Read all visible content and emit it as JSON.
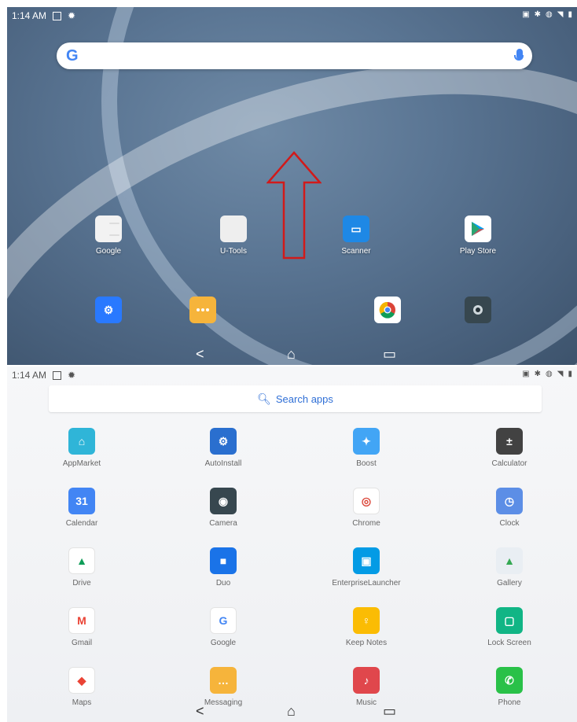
{
  "screens": {
    "home": {
      "status": {
        "time": "1:14 AM"
      },
      "search": {
        "logo": "G"
      },
      "apps": [
        {
          "label": "Google",
          "icon": "google-folder-icon"
        },
        {
          "label": "U-Tools",
          "icon": "utools-folder-icon"
        },
        {
          "label": "Scanner",
          "icon": "scanner-icon"
        },
        {
          "label": "Play Store",
          "icon": "play-store-icon"
        }
      ],
      "dock": [
        {
          "icon": "settings-icon"
        },
        {
          "icon": "messaging-icon"
        },
        {
          "icon": "chrome-icon"
        },
        {
          "icon": "camera-icon"
        }
      ],
      "nav": {
        "back": "<",
        "home": "⌂",
        "recents": "▭"
      }
    },
    "drawer": {
      "status": {
        "time": "1:14 AM"
      },
      "search_label": "Search apps",
      "apps": [
        {
          "label": "AppMarket",
          "icon": "appmarket-icon",
          "color": "#2fb5d8"
        },
        {
          "label": "AutoInstall",
          "icon": "autoinstall-icon",
          "color": "#2a6fcf"
        },
        {
          "label": "Boost",
          "icon": "boost-icon",
          "color": "#42a5f5"
        },
        {
          "label": "Calculator",
          "icon": "calculator-icon",
          "color": "#424242"
        },
        {
          "label": "Calendar",
          "icon": "calendar-icon",
          "color": "#4285f4"
        },
        {
          "label": "Camera",
          "icon": "camera-icon",
          "color": "#37474f"
        },
        {
          "label": "Chrome",
          "icon": "chrome-icon",
          "color": "#ffffff"
        },
        {
          "label": "Clock",
          "icon": "clock-icon",
          "color": "#5c8ee6"
        },
        {
          "label": "Drive",
          "icon": "drive-icon",
          "color": "#ffffff"
        },
        {
          "label": "Duo",
          "icon": "duo-icon",
          "color": "#1a73e8"
        },
        {
          "label": "EnterpriseLauncher",
          "icon": "enterprise-launcher-icon",
          "color": "#039be5"
        },
        {
          "label": "Gallery",
          "icon": "gallery-icon",
          "color": "#e9eef3"
        },
        {
          "label": "Gmail",
          "icon": "gmail-icon",
          "color": "#ffffff"
        },
        {
          "label": "Google",
          "icon": "google-icon",
          "color": "#ffffff"
        },
        {
          "label": "Keep Notes",
          "icon": "keep-notes-icon",
          "color": "#fbbc04"
        },
        {
          "label": "Lock Screen",
          "icon": "lock-screen-icon",
          "color": "#11b585"
        },
        {
          "label": "Maps",
          "icon": "maps-icon",
          "color": "#ffffff"
        },
        {
          "label": "Messaging",
          "icon": "messaging-icon",
          "color": "#f6b43b"
        },
        {
          "label": "Music",
          "icon": "music-icon",
          "color": "#e0474c"
        },
        {
          "label": "Phone",
          "icon": "phone-icon",
          "color": "#29c148"
        }
      ],
      "nav": {
        "back": "<",
        "home": "⌂",
        "recents": "▭"
      }
    }
  },
  "annotation": {
    "arrow_color": "#d11a1a"
  }
}
